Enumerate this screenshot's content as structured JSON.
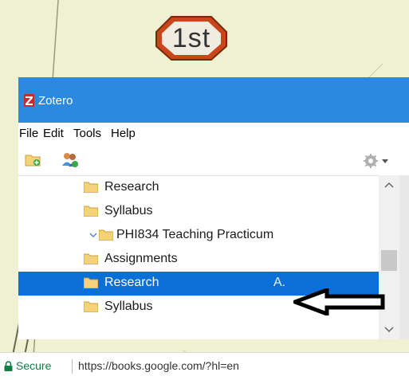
{
  "badge": {
    "text": "1st"
  },
  "window": {
    "title": "Zotero"
  },
  "menu": [
    {
      "label": "File"
    },
    {
      "label": "Edit"
    },
    {
      "label": "Tools"
    },
    {
      "label": "Help"
    }
  ],
  "toolbar": {
    "icons": [
      "new-collection-icon",
      "new-group-icon",
      "actions-gear-icon"
    ]
  },
  "tree": {
    "rows": [
      {
        "label": "Research",
        "level": 2,
        "selected": false
      },
      {
        "label": "Syllabus",
        "level": 2,
        "selected": false
      },
      {
        "label": "PHI834 Teaching Practicum",
        "level": 1,
        "expanded": true,
        "selected": false
      },
      {
        "label": "Assignments",
        "level": 2,
        "selected": false
      },
      {
        "label": "Research",
        "level": 2,
        "selected": true,
        "marker": "A."
      },
      {
        "label": "Syllabus",
        "level": 2,
        "selected": false
      }
    ]
  },
  "browser": {
    "secure_label": "Secure",
    "url": "https://books.google.com/?hl=en"
  },
  "colors": {
    "background": "#eef1d2",
    "titlebar": "#2b8ae0",
    "selection": "#0a6fd6",
    "badge_fill": "#c8461a",
    "secure_green": "#0b8043"
  }
}
